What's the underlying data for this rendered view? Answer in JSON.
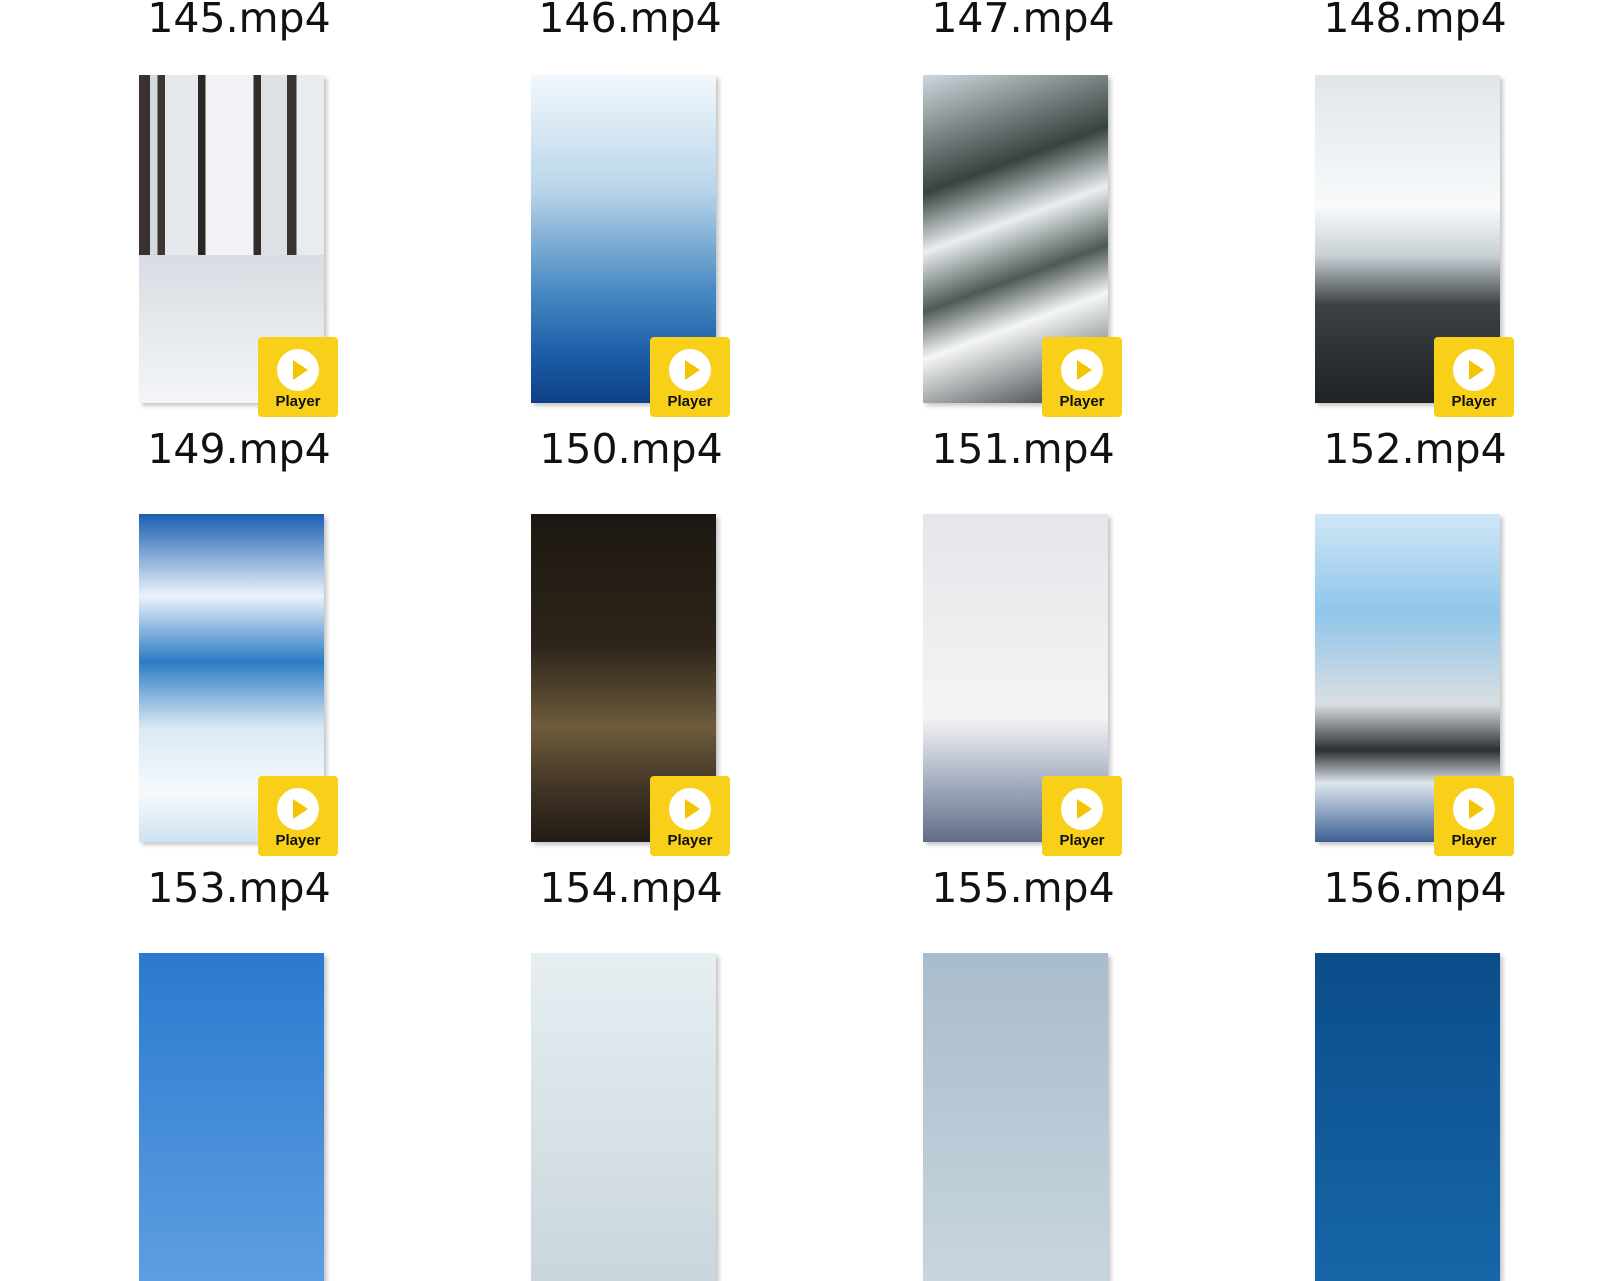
{
  "badge_label": "Player",
  "colors": {
    "badge": "#f8d01a",
    "background": "#ffffff"
  },
  "rows": [
    {
      "files": [
        {
          "name": "145.mp4"
        },
        {
          "name": "146.mp4"
        },
        {
          "name": "147.mp4"
        },
        {
          "name": "148.mp4"
        }
      ]
    },
    {
      "files": [
        {
          "name": "149.mp4"
        },
        {
          "name": "150.mp4"
        },
        {
          "name": "151.mp4"
        },
        {
          "name": "152.mp4"
        }
      ]
    },
    {
      "files": [
        {
          "name": "153.mp4"
        },
        {
          "name": "154.mp4"
        },
        {
          "name": "155.mp4"
        },
        {
          "name": "156.mp4"
        }
      ]
    },
    {
      "files": [
        {
          "name": ""
        },
        {
          "name": ""
        },
        {
          "name": ""
        },
        {
          "name": ""
        }
      ]
    }
  ]
}
